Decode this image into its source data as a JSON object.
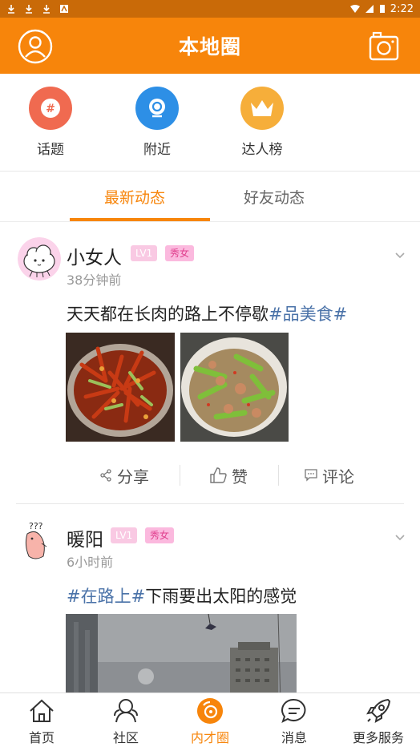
{
  "status_bar": {
    "time": "2:22"
  },
  "header": {
    "title": "本地圈"
  },
  "quick_links": [
    {
      "label": "话题",
      "icon": "hash-icon",
      "color": "#f26b4c"
    },
    {
      "label": "附近",
      "icon": "location-icon",
      "color": "#2d8fe6"
    },
    {
      "label": "达人榜",
      "icon": "crown-icon",
      "color": "#f5a623"
    }
  ],
  "tabs": [
    {
      "label": "最新动态",
      "active": true
    },
    {
      "label": "好友动态",
      "active": false
    }
  ],
  "posts": [
    {
      "author": "小女人",
      "level": "LV1",
      "badge": "秀女",
      "time": "38分钟前",
      "text_before": "天天都在长肉的路上不停歇",
      "tag": "#品美食#",
      "text_after": "",
      "images": [
        "crayfish-photo",
        "stir-fry-photo"
      ]
    },
    {
      "author": "暖阳",
      "level": "LV1",
      "badge": "秀女",
      "time": "6小时前",
      "text_before": "",
      "tag": "#在路上#",
      "text_after": "下雨要出太阳的感觉",
      "images": [
        "cloudy-sky-photo"
      ]
    }
  ],
  "actions": {
    "share": "分享",
    "like": "赞",
    "comment": "评论"
  },
  "bottom_nav": [
    {
      "label": "首页",
      "icon": "home-icon"
    },
    {
      "label": "社区",
      "icon": "community-icon"
    },
    {
      "label": "内才圈",
      "icon": "circle-icon",
      "active": true
    },
    {
      "label": "消息",
      "icon": "message-icon"
    },
    {
      "label": "更多服务",
      "icon": "rocket-icon"
    }
  ],
  "colors": {
    "brand": "#f7850b",
    "tag": "#4a72a8"
  }
}
